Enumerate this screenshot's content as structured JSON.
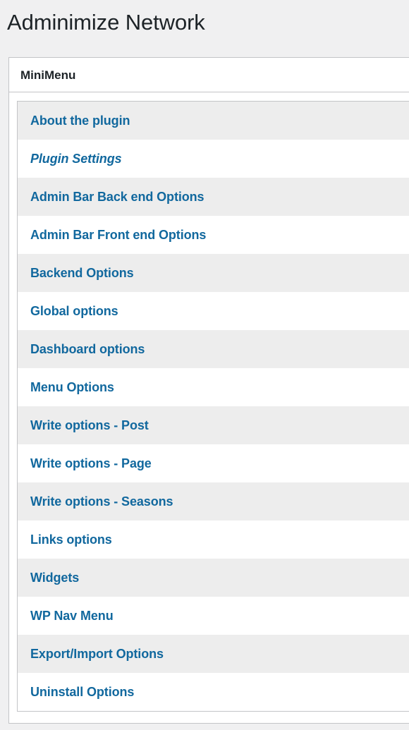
{
  "page": {
    "title": "Adminimize Network",
    "background_color": "#f0f0f1",
    "title_color": "#1d2327"
  },
  "minimenu": {
    "header": "MiniMenu",
    "link_color": "#11689e",
    "alt_row_color": "#ededed",
    "row_color": "#ffffff",
    "border_color": "#c3c4c7",
    "items": [
      {
        "label": "About the plugin",
        "current": false
      },
      {
        "label": "Plugin Settings",
        "current": true
      },
      {
        "label": "Admin Bar Back end Options",
        "current": false
      },
      {
        "label": "Admin Bar Front end Options",
        "current": false
      },
      {
        "label": "Backend Options",
        "current": false
      },
      {
        "label": "Global options",
        "current": false
      },
      {
        "label": "Dashboard options",
        "current": false
      },
      {
        "label": "Menu Options",
        "current": false
      },
      {
        "label": "Write options - Post",
        "current": false
      },
      {
        "label": "Write options - Page",
        "current": false
      },
      {
        "label": "Write options - Seasons",
        "current": false
      },
      {
        "label": "Links options",
        "current": false
      },
      {
        "label": "Widgets",
        "current": false
      },
      {
        "label": "WP Nav Menu",
        "current": false
      },
      {
        "label": "Export/Import Options",
        "current": false
      },
      {
        "label": "Uninstall Options",
        "current": false
      }
    ]
  }
}
